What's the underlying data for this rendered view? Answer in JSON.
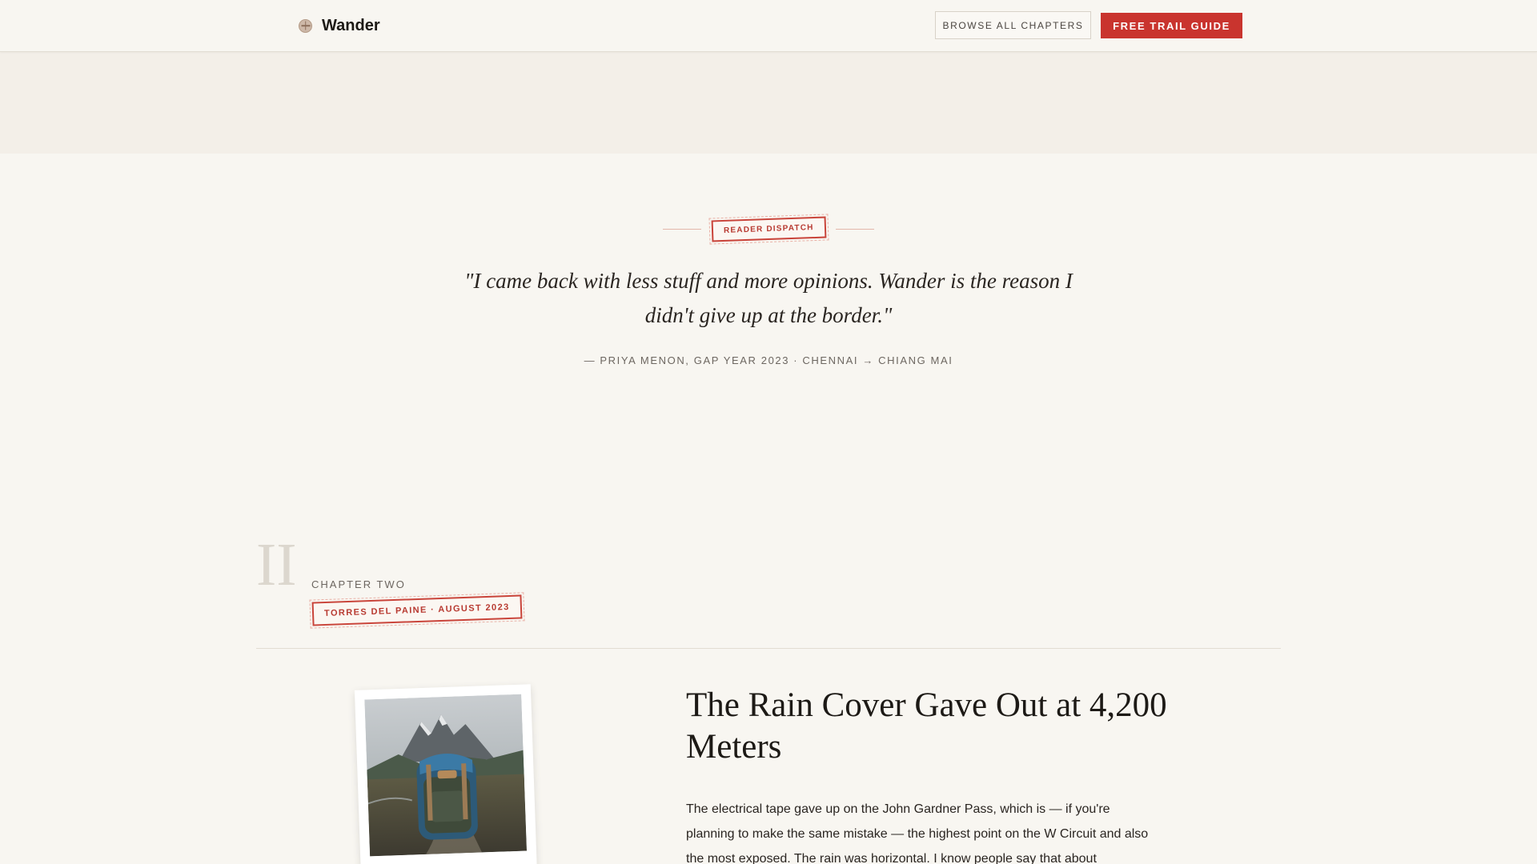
{
  "header": {
    "brand_name": "Wander",
    "brand_icon": "compass-icon",
    "browse_label": "BROWSE ALL CHAPTERS",
    "cta_label": "FREE TRAIL GUIDE"
  },
  "testimonial": {
    "stamp_label": "READER DISPATCH",
    "quote": "\"I came back with less stuff and more opinions. Wander is the reason I didn't give up at the border.\"",
    "attribution": "— PRIYA MENON, GAP YEAR 2023 · CHENNAI → CHIANG MAI"
  },
  "chapter": {
    "numeral": "II",
    "label": "CHAPTER TWO",
    "stamp": "TORRES DEL PAINE · AUGUST 2023",
    "photo_icon": "backpack-mountains-image",
    "title": "The Rain Cover Gave Out at 4,200 Meters",
    "body": "The electrical tape gave up on the John Gardner Pass, which is — if you're planning to make the same mistake — the highest point on the W Circuit and also the most exposed. The rain was horizontal. I know people say that about"
  },
  "colors": {
    "accent": "#c9342e",
    "background": "#f8f6f1",
    "band": "#f3efe8"
  }
}
